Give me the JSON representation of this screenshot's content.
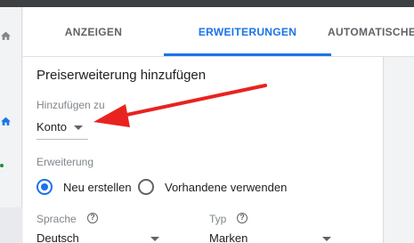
{
  "tabs": [
    {
      "label": "ANZEIGEN",
      "active": false
    },
    {
      "label": "ERWEITERUNGEN",
      "active": true
    },
    {
      "label": "AUTOMATISCHE ERWEITERUNGEN",
      "active": false
    }
  ],
  "form": {
    "title": "Preiserweiterung hinzufügen",
    "add_to_label": "Hinzufügen zu",
    "add_to_value": "Konto",
    "extension_label": "Erweiterung",
    "radio_new": "Neu erstellen",
    "radio_existing": "Vorhandene verwenden",
    "language_label": "Sprache",
    "language_value": "Deutsch",
    "type_label": "Typ",
    "type_value": "Marken",
    "help_glyph": "?"
  },
  "icons": {
    "rail_top": "home-icon",
    "rail_active": "home-icon",
    "help": "help-circle-icon",
    "dropdown": "caret-down-icon"
  },
  "colors": {
    "accent": "#1a73e8",
    "annotation_arrow": "#e8231f"
  }
}
